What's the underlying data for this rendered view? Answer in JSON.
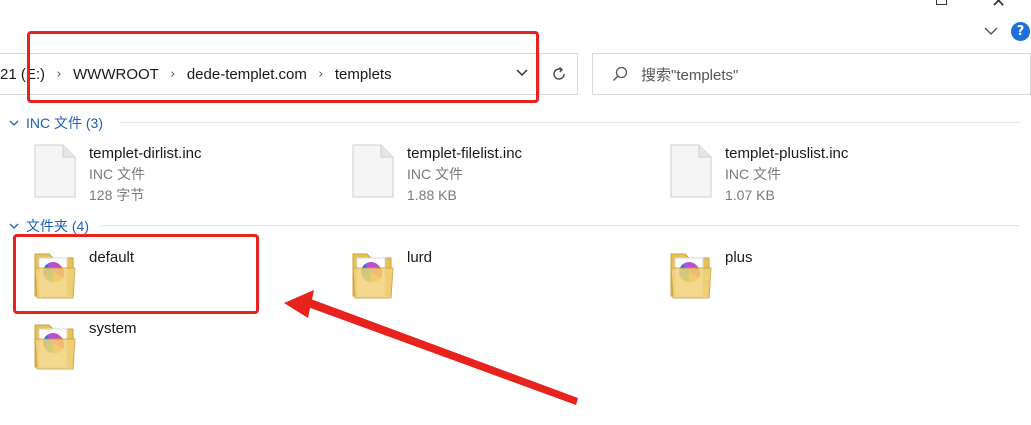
{
  "window": {
    "close_glyph": "✕",
    "help_label": "?"
  },
  "address": {
    "crumbs": [
      "21 (E:)",
      "WWWROOT",
      "dede-templet.com",
      "templets"
    ]
  },
  "search": {
    "placeholder": "搜索\"templets\""
  },
  "groups": [
    {
      "header": "INC 文件 (3)",
      "items": [
        {
          "name": "templet-dirlist.inc",
          "type": "INC 文件",
          "size": "128 字节",
          "icon": "document-icon"
        },
        {
          "name": "templet-filelist.inc",
          "type": "INC 文件",
          "size": "1.88 KB",
          "icon": "document-icon"
        },
        {
          "name": "templet-pluslist.inc",
          "type": "INC 文件",
          "size": "1.07 KB",
          "icon": "document-icon"
        }
      ]
    },
    {
      "header": "文件夹 (4)",
      "items": [
        {
          "name": "default",
          "icon": "folder-icon"
        },
        {
          "name": "lurd",
          "icon": "folder-icon"
        },
        {
          "name": "plus",
          "icon": "folder-icon"
        },
        {
          "name": "system",
          "icon": "folder-icon"
        }
      ]
    }
  ],
  "colors": {
    "annotation_red": "#e8231e",
    "group_header_blue": "#1f5fb8",
    "help_blue": "#1e6fd9"
  }
}
